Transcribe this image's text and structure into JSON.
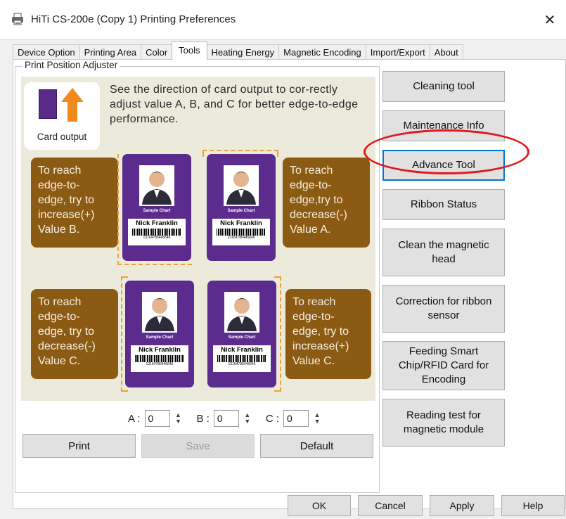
{
  "window": {
    "title": "HiTi CS-200e (Copy 1) Printing Preferences",
    "close_glyph": "✕",
    "icon": "printer-icon"
  },
  "tabs": [
    {
      "label": "Device Option"
    },
    {
      "label": "Printing Area"
    },
    {
      "label": "Color"
    },
    {
      "label": "Tools",
      "active": true
    },
    {
      "label": "Heating Energy"
    },
    {
      "label": "Magnetic Encoding"
    },
    {
      "label": "Import/Export"
    },
    {
      "label": "About"
    }
  ],
  "adjuster": {
    "legend": "Print Position Adjuster",
    "card_output_label": "Card output",
    "instruction": "See the direction of card output to cor-rectly adjust value A, B, and C for better edge-to-edge performance.",
    "bubbles": {
      "top_left": "To reach\nedge-to-\nedge, try to\nincrease(+)\nValue B.",
      "top_right": "To reach\nedge-to-\nedge,try to\ndecrease(-)\nValue A.",
      "bottom_left": "To reach\nedge-to-\nedge, try to\ndecrease(-)\nValue C.",
      "bottom_right": "To reach\nedge-to-\nedge, try to\nincrease(+)\nValue C."
    },
    "card": {
      "sample_label": "Sample Chart",
      "name": "Nick Franklin",
      "barcode_number": "13164786445646"
    },
    "values": {
      "a_label": "A :",
      "a_value": "0",
      "b_label": "B :",
      "b_value": "0",
      "c_label": "C :",
      "c_value": "0"
    },
    "buttons": {
      "print": "Print",
      "save": "Save",
      "default": "Default"
    }
  },
  "tools": {
    "cleaning": "Cleaning tool",
    "maintenance": "Maintenance Info",
    "advance": "Advance Tool",
    "ribbon_status": "Ribbon Status",
    "clean_mag": "Clean the magnetic\nhead",
    "ribbon_sensor": "Correction for ribbon\nsensor",
    "feeding_smart": "Feeding Smart\nChip/RFID Card for\nEncoding",
    "reading_test": "Reading test for\nmagnetic module"
  },
  "dialog_buttons": {
    "ok": "OK",
    "cancel": "Cancel",
    "apply": "Apply",
    "help": "Help"
  },
  "colors": {
    "card_purple": "#5b2b8e",
    "bubble_brown": "#8b5a13",
    "arrow_orange": "#f08a1c",
    "highlight_red": "#e2171b",
    "illustration_bg": "#eceadb"
  }
}
